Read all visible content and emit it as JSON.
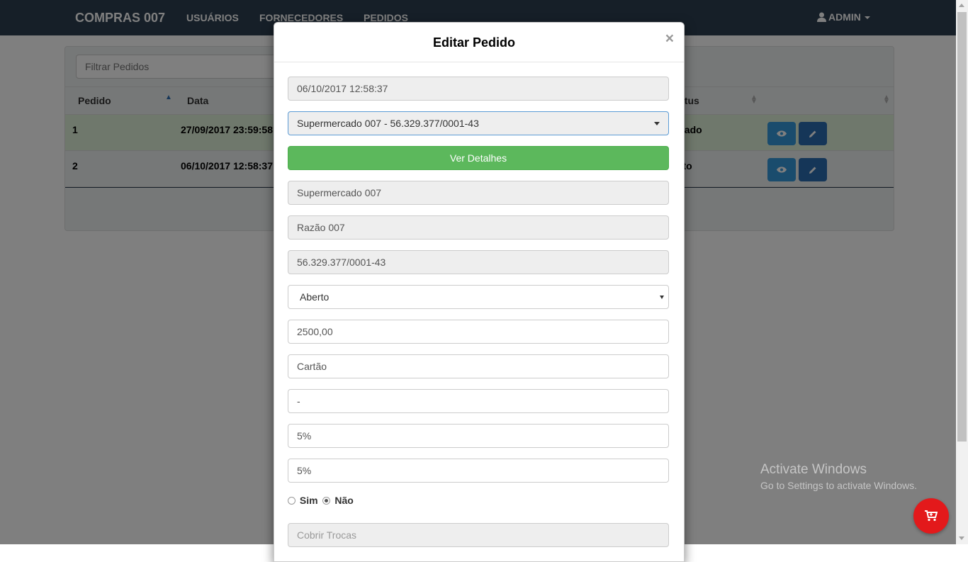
{
  "navbar": {
    "brand": "COMPRAS 007",
    "links": [
      "USUÁRIOS",
      "FORNECEDORES",
      "PEDIDOS"
    ],
    "user": "ADMIN"
  },
  "page": {
    "filter_placeholder": "Filtrar Pedidos",
    "columns": [
      "Pedido",
      "Data",
      "atus"
    ],
    "rows": [
      {
        "pedido": "1",
        "data": "27/09/2017 23:59:58",
        "status": "xado"
      },
      {
        "pedido": "2",
        "data": "06/10/2017 12:58:37",
        "status": "rto"
      }
    ]
  },
  "modal": {
    "title": "Editar Pedido",
    "close": "×",
    "date_field": "06/10/2017 12:58:37",
    "supplier_select": "Supermercado 007 - 56.329.377/0001-43",
    "details_button": "Ver Detalhes",
    "fantasy_name": "Supermercado 007",
    "company_name": "Razão 007",
    "cnpj": "56.329.377/0001-43",
    "status_select": "Aberto",
    "value": "2500,00",
    "payment": "Cartão",
    "field_dash": "-",
    "percent_1": "5%",
    "percent_2": "5%",
    "radio_yes": "Sim",
    "radio_no": "Não",
    "cover_exchanges_placeholder": "Cobrir Trocas"
  },
  "watermark": {
    "title": "Activate Windows",
    "subtitle": "Go to Settings to activate Windows."
  },
  "colors": {
    "navbar": "#2c3e50",
    "success": "#5cb85c",
    "row_highlight": "#dff0d8",
    "fab": "#e3191b"
  }
}
